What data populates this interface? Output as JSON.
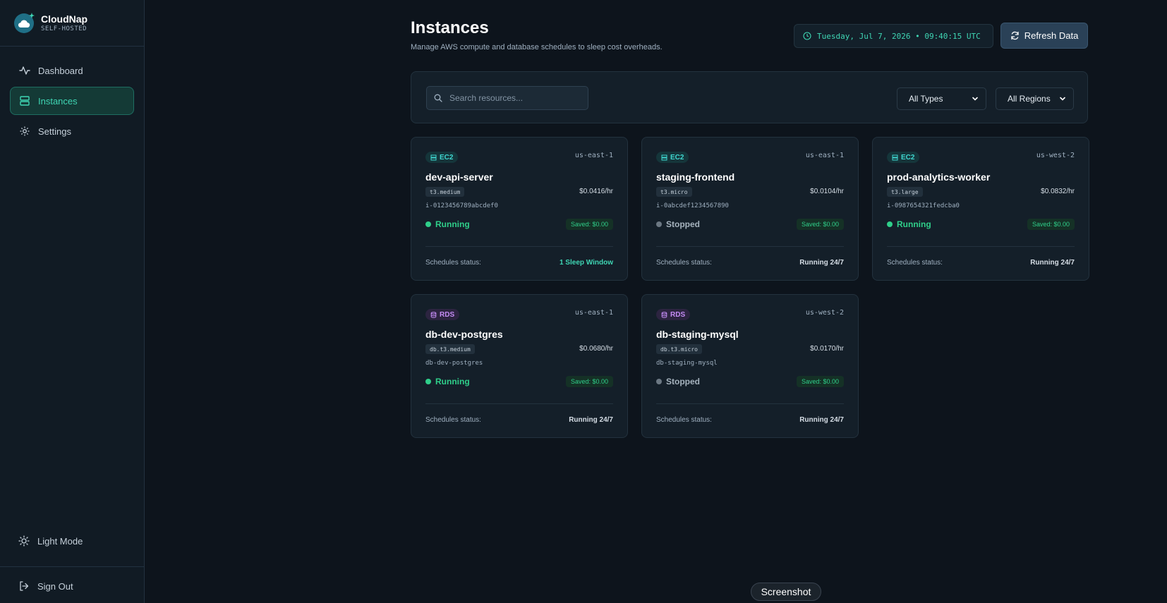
{
  "brand": {
    "name": "CloudNap",
    "subtitle": "SELF-HOSTED"
  },
  "sidebar": {
    "items": [
      {
        "label": "Dashboard",
        "icon": "activity-icon"
      },
      {
        "label": "Instances",
        "icon": "server-icon",
        "active": true
      },
      {
        "label": "Settings",
        "icon": "gear-icon"
      }
    ],
    "theme_toggle": "Light Mode",
    "sign_out": "Sign Out"
  },
  "header": {
    "title": "Instances",
    "subtitle": "Manage AWS compute and database schedules to sleep cost overheads.",
    "clock": "Tuesday, Jul 7, 2026 • 09:40:15 UTC",
    "refresh_label": "Refresh Data"
  },
  "filters": {
    "search_placeholder": "Search resources...",
    "search_value": "",
    "type_selected": "All Types",
    "region_selected": "All Regions"
  },
  "labels": {
    "schedules_status": "Schedules status:"
  },
  "colors": {
    "accent": "#3fd6b4",
    "running": "#2fcf8a",
    "stopped": "#6c7883",
    "ec2_badge": "#3fd6d0",
    "rds_badge": "#c58cf5"
  },
  "instances": [
    {
      "kind": "EC2",
      "region": "us-east-1",
      "name": "dev-api-server",
      "size": "t3.medium",
      "price": "$0.0416/hr",
      "id": "i-0123456789abcdef0",
      "status": "Running",
      "saved": "Saved: $0.00",
      "schedule": "1 Sleep Window"
    },
    {
      "kind": "EC2",
      "region": "us-east-1",
      "name": "staging-frontend",
      "size": "t3.micro",
      "price": "$0.0104/hr",
      "id": "i-0abcdef1234567890",
      "status": "Stopped",
      "saved": "Saved: $0.00",
      "schedule": "Running 24/7"
    },
    {
      "kind": "EC2",
      "region": "us-west-2",
      "name": "prod-analytics-worker",
      "size": "t3.large",
      "price": "$0.0832/hr",
      "id": "i-0987654321fedcba0",
      "status": "Running",
      "saved": "Saved: $0.00",
      "schedule": "Running 24/7"
    },
    {
      "kind": "RDS",
      "region": "us-east-1",
      "name": "db-dev-postgres",
      "size": "db.t3.medium",
      "price": "$0.0680/hr",
      "id": "db-dev-postgres",
      "status": "Running",
      "saved": "Saved: $0.00",
      "schedule": "Running 24/7"
    },
    {
      "kind": "RDS",
      "region": "us-west-2",
      "name": "db-staging-mysql",
      "size": "db.t3.micro",
      "price": "$0.0170/hr",
      "id": "db-staging-mysql",
      "status": "Stopped",
      "saved": "Saved: $0.00",
      "schedule": "Running 24/7"
    }
  ],
  "overlay": {
    "screenshot_label": "Screenshot"
  }
}
